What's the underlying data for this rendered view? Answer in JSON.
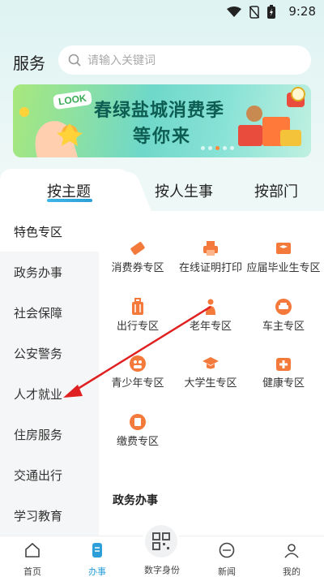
{
  "status_bar": {
    "time": "9:28"
  },
  "header": {
    "title": "服务",
    "search_placeholder": "请输入关键词"
  },
  "banner": {
    "badge": "LOOK",
    "line1": "春绿盐城消费季",
    "line2": "等你来",
    "slides": 5,
    "active_slide": 1
  },
  "tabs": [
    {
      "label": "按主题",
      "active": true
    },
    {
      "label": "按人生事",
      "active": false
    },
    {
      "label": "按部门",
      "active": false
    }
  ],
  "sidebar": {
    "items": [
      {
        "label": "特色专区",
        "active": true
      },
      {
        "label": "政务办事",
        "active": false
      },
      {
        "label": "社会保障",
        "active": false
      },
      {
        "label": "公安警务",
        "active": false
      },
      {
        "label": "人才就业",
        "active": false
      },
      {
        "label": "住房服务",
        "active": false
      },
      {
        "label": "交通出行",
        "active": false
      },
      {
        "label": "学习教育",
        "active": false
      }
    ]
  },
  "grid": {
    "items": [
      {
        "label": "消费券专区",
        "icon": "ticket-icon"
      },
      {
        "label": "在线证明打印",
        "icon": "printer-icon"
      },
      {
        "label": "应届毕业生专区",
        "icon": "graduate-card-icon"
      },
      {
        "label": "出行专区",
        "icon": "luggage-icon"
      },
      {
        "label": "老年专区",
        "icon": "elderly-icon"
      },
      {
        "label": "车主专区",
        "icon": "car-icon"
      },
      {
        "label": "青少年专区",
        "icon": "youth-icon"
      },
      {
        "label": "大学生专区",
        "icon": "graduation-cap-icon"
      },
      {
        "label": "健康专区",
        "icon": "medical-kit-icon"
      },
      {
        "label": "缴费专区",
        "icon": "payment-icon"
      }
    ]
  },
  "section_title": "政务办事",
  "bottom_nav": {
    "items": [
      {
        "label": "首页",
        "icon": "home-icon",
        "active": false
      },
      {
        "label": "办事",
        "icon": "document-icon",
        "active": true
      },
      {
        "label": "数字身份",
        "icon": "qr-code-icon",
        "active": false
      },
      {
        "label": "新闻",
        "icon": "news-icon",
        "active": false
      },
      {
        "label": "我的",
        "icon": "user-icon",
        "active": false
      }
    ]
  },
  "colors": {
    "accent": "#2c9fd9",
    "icon_orange": "#f47a3c",
    "banner_text": "#0d5d52",
    "annotation_red": "#e02020"
  }
}
